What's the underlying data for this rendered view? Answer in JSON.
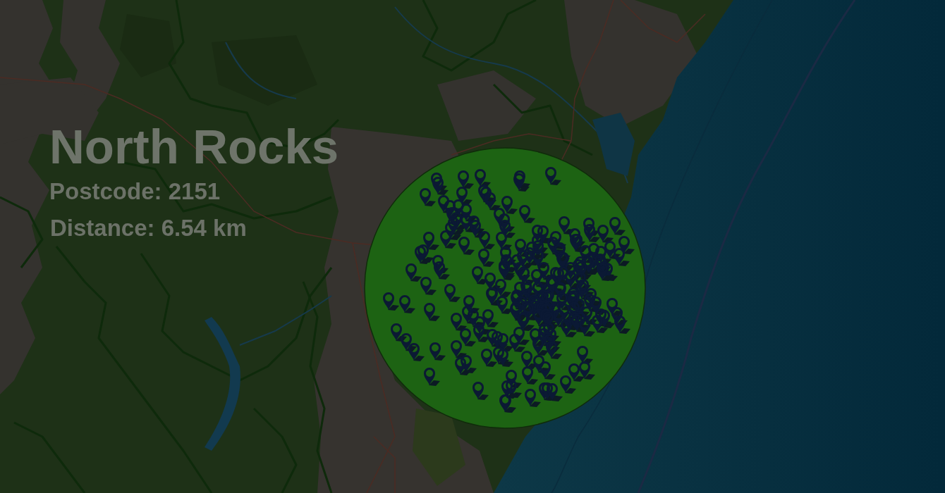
{
  "location": {
    "name": "North Rocks",
    "postcode": "Postcode: 2151",
    "distance": "Distance: 6.54 km"
  }
}
